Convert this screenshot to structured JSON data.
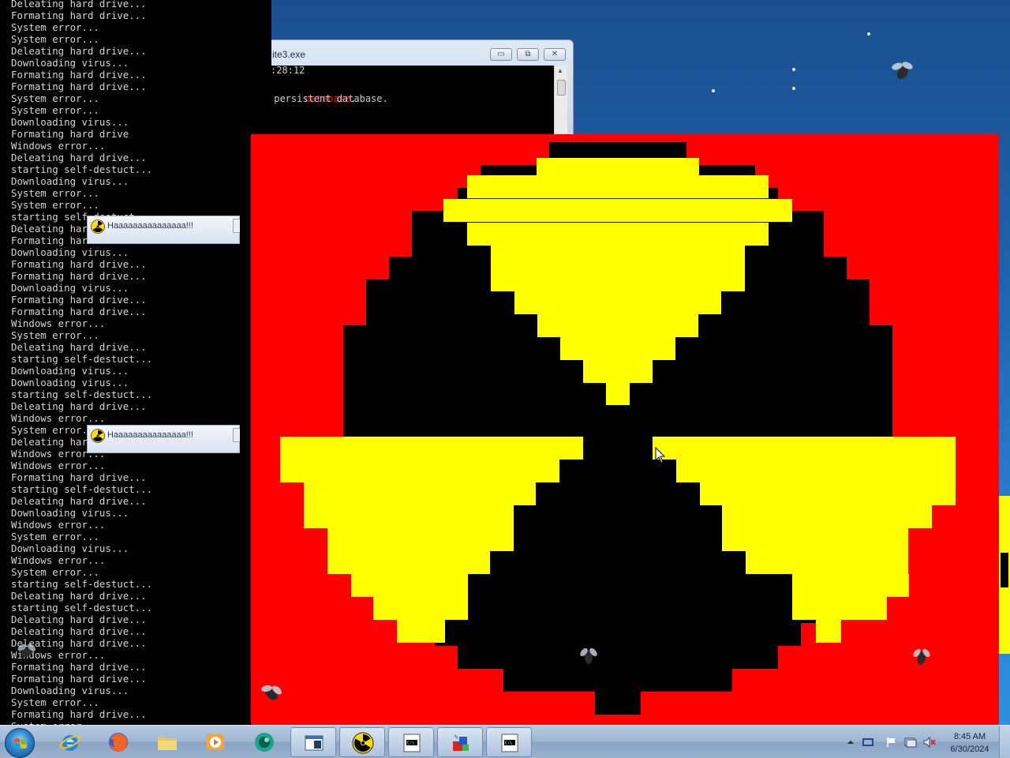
{
  "console": {
    "lines": [
      "Deleating hard drive...",
      "Formating hard drive...",
      "System error...",
      "System error...",
      "Deleating hard drive...",
      "Downloading virus...",
      "Formating hard drive...",
      "Formating hard drive...",
      "System error...",
      "System error...",
      "Downloading virus...",
      "Formating hard drive",
      "Windows error...",
      "Deleating hard drive...",
      "starting self-destuct...",
      "Downloading virus...",
      "System error...",
      "System error...",
      "starting self-destuct...",
      "Deleating hard drive...",
      "Formating hard drive...",
      "Downloading virus...",
      "Formating hard drive...",
      "Formating hard drive...",
      "Downloading virus...",
      "Formating hard drive...",
      "Formating hard drive...",
      "Windows error...",
      "System error...",
      "Deleating hard drive...",
      "starting self-destuct...",
      "Downloading virus...",
      "Downloading virus...",
      "starting self-destuct...",
      "Deleating hard drive...",
      "Windows error...",
      "System error...",
      "Deleating hard drive...",
      "Windows error...",
      "Windows error...",
      "Formating hard drive...",
      "starting self-destuct...",
      "Deleating hard drive...",
      "Downloading virus...",
      "Windows error...",
      "System error...",
      "Downloading virus...",
      "Windows error...",
      "System error...",
      "starting self-destuct...",
      "Deleating hard drive...",
      "starting self-destuct...",
      "Deleating hard drive...",
      "Deleating hard drive...",
      "Deleating hard drive...",
      "Windows error...",
      "Formating hard drive...",
      "Formating hard drive...",
      "Downloading virus...",
      "System error...",
      "Formating hard drive...",
      "System error..."
    ]
  },
  "sqlite_window": {
    "title": "ite3.exe",
    "minimize": "▭",
    "maximize": "⧉",
    "close": "✕",
    "line1": ":28:12",
    "line2_red": "database",
    "line2_dot": ".",
    "line3": " persistent database."
  },
  "popups": [
    {
      "title": "Haaaaaaaaaaaaaaa!!!"
    },
    {
      "title": "Haaaaaaaaaaaaaaa!!!"
    }
  ],
  "hazard": {
    "background": "#ff0000",
    "disk": "#000000",
    "blade": "#ffff00"
  },
  "taskbar": {
    "items": [
      "start",
      "internet-explorer",
      "firefox",
      "file-explorer",
      "media-player",
      "app-globe",
      "console-window",
      "hazard-app",
      "window-1",
      "installer",
      "window-2"
    ],
    "clock_time": "8:45 AM",
    "clock_date": "6/30/2024"
  }
}
